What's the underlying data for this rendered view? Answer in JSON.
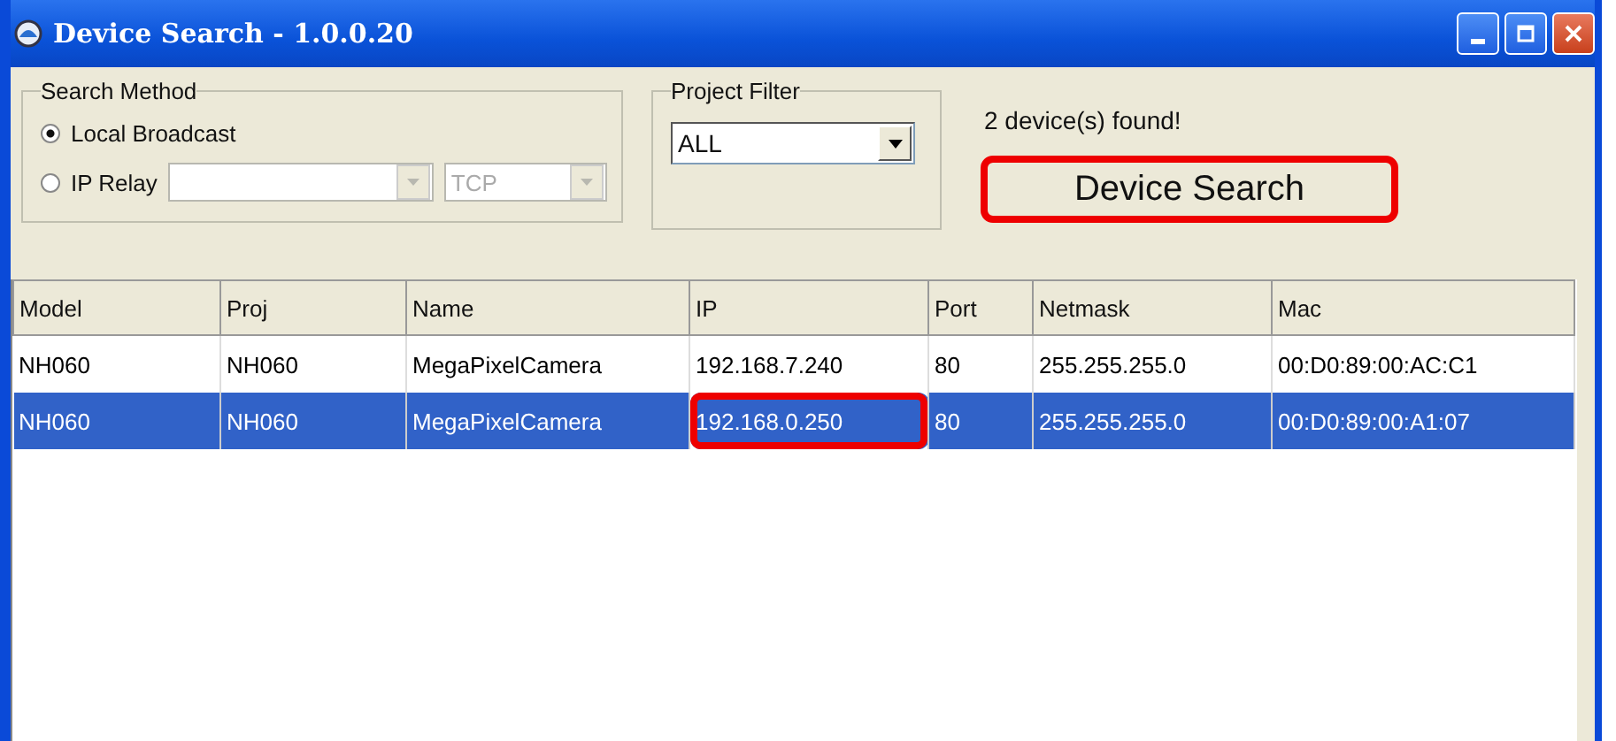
{
  "window": {
    "title": "Device Search - 1.0.0.20"
  },
  "search_method": {
    "title": "Search Method",
    "options": [
      {
        "label": "Local Broadcast",
        "selected": true
      },
      {
        "label": "IP Relay",
        "selected": false
      }
    ],
    "relay_fields": [
      {
        "disabled": true
      },
      {
        "value": "TCP",
        "disabled": true
      }
    ]
  },
  "project_filter": {
    "title": "Project Filter",
    "value": "ALL"
  },
  "status": "2 device(s) found!",
  "search_button": {
    "label": "Device Search",
    "highlighted": true
  },
  "table": {
    "columns": [
      "Model",
      "Proj",
      "Name",
      "IP",
      "Port",
      "Netmask",
      "Mac"
    ],
    "rows": [
      {
        "selected": false,
        "cells": [
          {
            "text": "NH060",
            "highlighted": false
          },
          {
            "text": "NH060",
            "highlighted": false
          },
          {
            "text": "MegaPixelCamera",
            "highlighted": false
          },
          {
            "text": "192.168.7.240",
            "highlighted": false
          },
          {
            "text": "80",
            "highlighted": false
          },
          {
            "text": "255.255.255.0",
            "highlighted": false
          },
          {
            "text": "00:D0:89:00:AC:C1",
            "highlighted": false
          }
        ]
      },
      {
        "selected": true,
        "cells": [
          {
            "text": "NH060",
            "highlighted": false
          },
          {
            "text": "NH060",
            "highlighted": false
          },
          {
            "text": "MegaPixelCamera",
            "highlighted": false
          },
          {
            "text": "192.168.0.250",
            "highlighted": true
          },
          {
            "text": "80",
            "highlighted": false
          },
          {
            "text": "255.255.255.0",
            "highlighted": false
          },
          {
            "text": "00:D0:89:00:A1:07",
            "highlighted": false
          }
        ]
      }
    ]
  }
}
